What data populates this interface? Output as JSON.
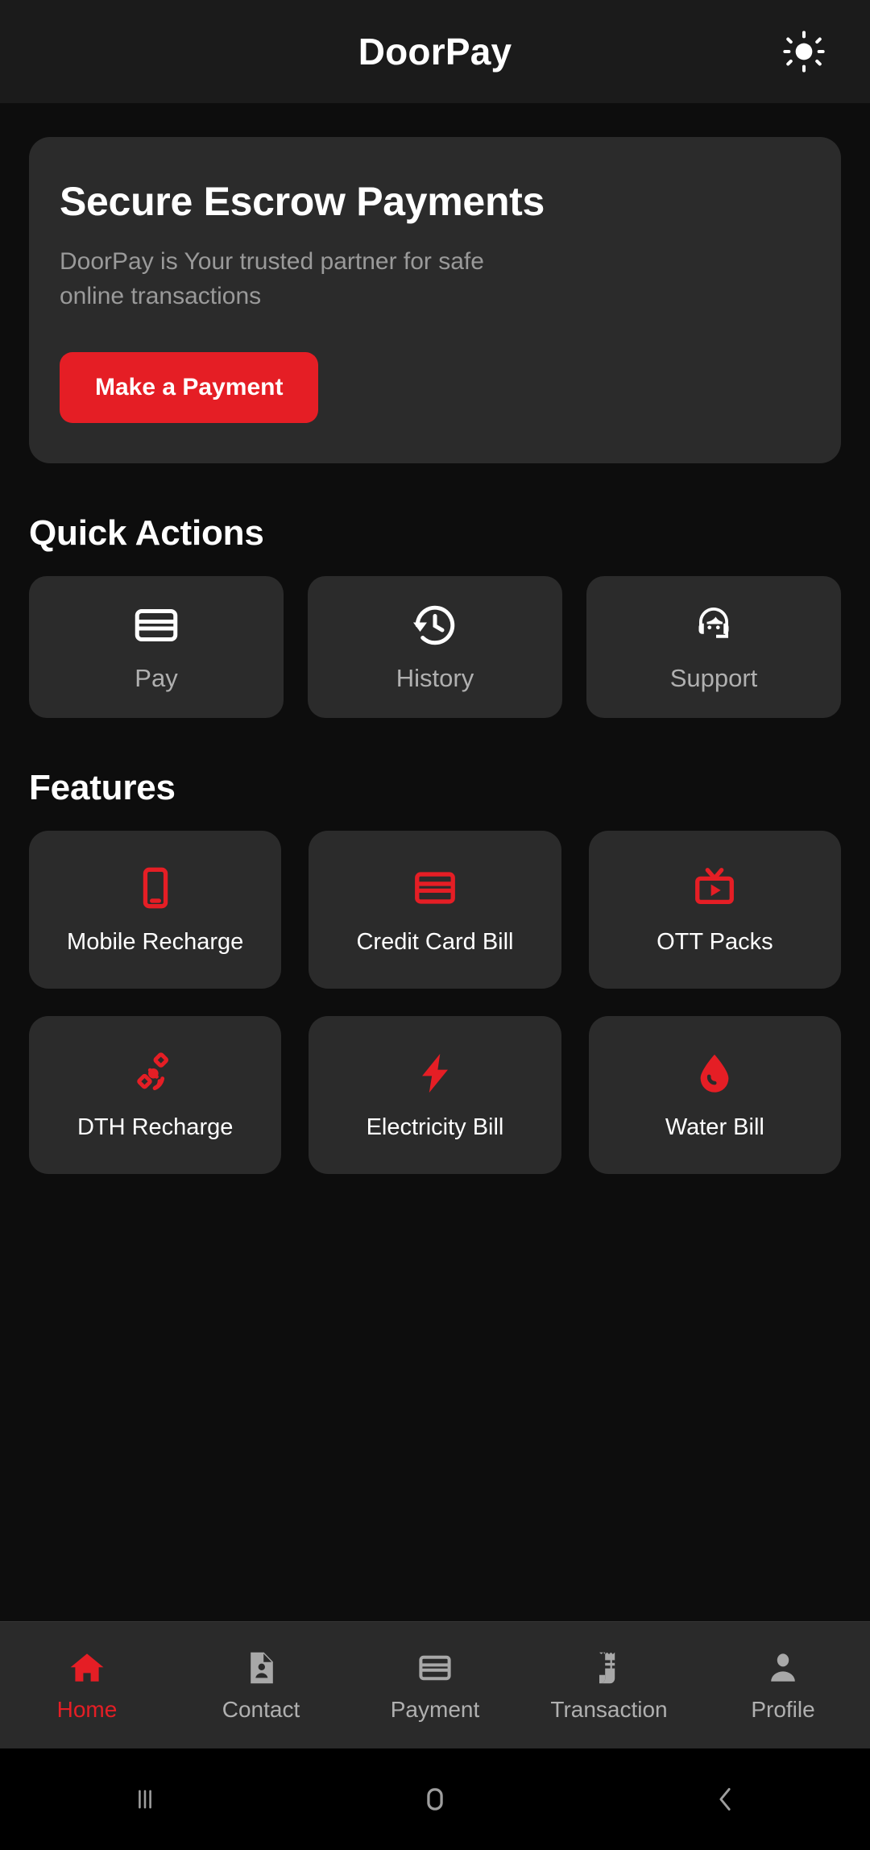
{
  "app": {
    "title": "DoorPay",
    "theme_toggle_icon": "sun-icon",
    "accent_color": "#e51e25",
    "background_color": "#0d0d0d",
    "card_color": "#2b2b2b"
  },
  "hero": {
    "title": "Secure Escrow Payments",
    "subtitle": "DoorPay is Your trusted partner for safe online transactions",
    "button_label": "Make a Payment"
  },
  "quick_actions": {
    "heading": "Quick Actions",
    "items": [
      {
        "label": "Pay",
        "icon": "credit-card-icon"
      },
      {
        "label": "History",
        "icon": "history-clock-icon"
      },
      {
        "label": "Support",
        "icon": "headset-support-icon"
      }
    ]
  },
  "features": {
    "heading": "Features",
    "items": [
      {
        "label": "Mobile Recharge",
        "icon": "smartphone-icon"
      },
      {
        "label": "Credit Card Bill",
        "icon": "credit-card-icon"
      },
      {
        "label": "OTT Packs",
        "icon": "tv-play-icon"
      },
      {
        "label": "DTH Recharge",
        "icon": "satellite-icon"
      },
      {
        "label": "Electricity Bill",
        "icon": "lightning-bolt-icon"
      },
      {
        "label": "Water Bill",
        "icon": "water-drop-icon"
      }
    ]
  },
  "bottom_nav": {
    "active": "Home",
    "items": [
      {
        "label": "Home",
        "icon": "home-icon",
        "active": true
      },
      {
        "label": "Contact",
        "icon": "contact-document-icon",
        "active": false
      },
      {
        "label": "Payment",
        "icon": "credit-card-icon",
        "active": false
      },
      {
        "label": "Transaction",
        "icon": "receipt-icon",
        "active": false
      },
      {
        "label": "Profile",
        "icon": "person-icon",
        "active": false
      }
    ]
  },
  "system_nav": {
    "items": [
      {
        "name": "recents-button",
        "icon": "recents-bars-icon"
      },
      {
        "name": "home-button",
        "icon": "home-rounded-square-icon"
      },
      {
        "name": "back-button",
        "icon": "back-chevron-icon"
      }
    ]
  }
}
